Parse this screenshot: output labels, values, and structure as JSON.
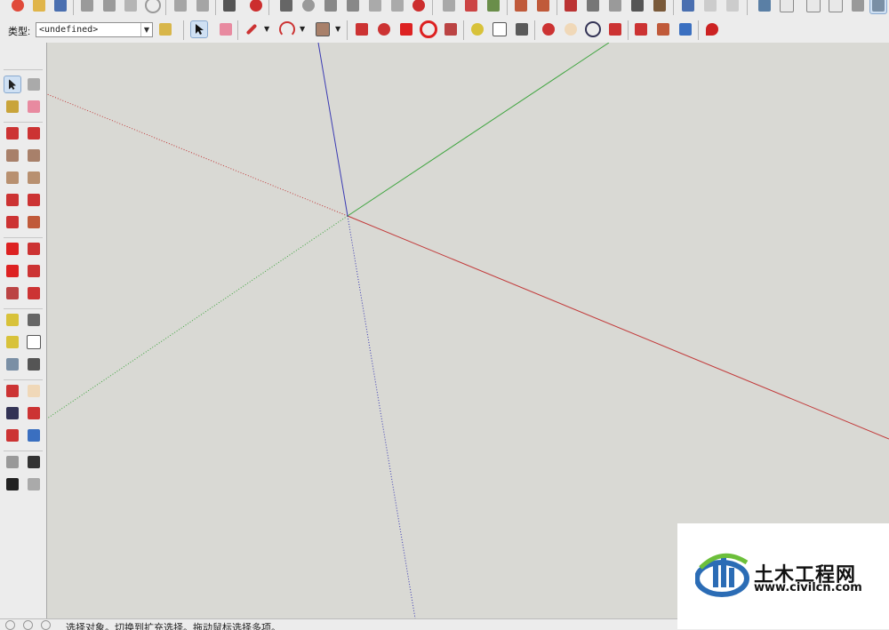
{
  "toolbar": {
    "layer_label": "类型:",
    "layer_value": "<undefined>",
    "layer_dropdown_icon": "chevron-down-icon",
    "top_row_icons": [
      "new-file-icon",
      "open-icon",
      "save-icon",
      "cut-icon",
      "copy-icon",
      "paste-icon",
      "erase-icon",
      "undo-icon",
      "redo-icon",
      "print-icon",
      "model-info-icon",
      "walkthrough-icon",
      "camera-icon",
      "position-camera-icon",
      "look-around-icon",
      "section-plane-icon",
      "display-section-icon",
      "hide-section-icon",
      "rotate-icon",
      "match-photo-icon",
      "sandbox-icon",
      "terrain-icon",
      "drape-icon",
      "stamp-icon",
      "flip-edge-icon",
      "add-detail-icon",
      "smoove-icon",
      "warehouse-icon",
      "share-model-icon",
      "extension-icon",
      "iso-view-icon",
      "top-view-icon",
      "front-view-icon",
      "right-view-icon",
      "back-view-icon",
      "left-view-icon"
    ],
    "bottom_row_icons": [
      "layer-manager-icon",
      "select-icon",
      "eraser-icon",
      "pencil-icon",
      "arc-icon",
      "rectangle-icon",
      "pushpull-icon",
      "followme-icon",
      "move-icon",
      "rotate-icon",
      "scale-icon",
      "tape-measure-icon",
      "text-icon",
      "paint-bucket-icon",
      "orbit-icon",
      "pan-icon",
      "zoom-icon",
      "zoom-extents-icon",
      "components-icon",
      "materials-icon",
      "styles-icon",
      "ruby-icon"
    ]
  },
  "left_toolbar": {
    "tools": [
      "select-icon",
      "make-component-icon",
      "paint-bucket-icon",
      "eraser-icon",
      "pencil-icon",
      "freehand-icon",
      "rectangle-icon",
      "rotated-rectangle-icon",
      "circle-icon",
      "polygon-icon",
      "arc-icon",
      "two-point-arc-icon",
      "three-point-arc-icon",
      "pie-icon",
      "move-icon",
      "pushpull-icon",
      "rotate-icon",
      "followme-icon",
      "scale-icon",
      "offset-icon",
      "tape-measure-icon",
      "dimension-icon",
      "protractor-icon",
      "text-icon",
      "axes-icon",
      "3d-text-icon",
      "orbit-icon",
      "pan-icon",
      "zoom-icon",
      "zoom-window-icon",
      "zoom-extents-icon",
      "previous-view-icon",
      "position-camera-icon",
      "look-around-icon",
      "walk-icon",
      "section-plane-icon"
    ]
  },
  "status_bar": {
    "hint_text": "选择对象。切换到扩充选择。拖动鼠标选择多项。",
    "icons": [
      "info-icon",
      "geo-icon",
      "credits-icon"
    ]
  },
  "watermark": {
    "title": "土木工程网",
    "url": "www.civilcn.com",
    "logo_icon": "civil-logo-icon"
  },
  "colors": {
    "background": "#d9d9d4",
    "red_axis": "#c23a3a",
    "green_axis": "#3fa53f",
    "blue_axis": "#3b3bb3",
    "logo_blue": "#2b6cb5",
    "logo_green": "#6cbf3a"
  }
}
